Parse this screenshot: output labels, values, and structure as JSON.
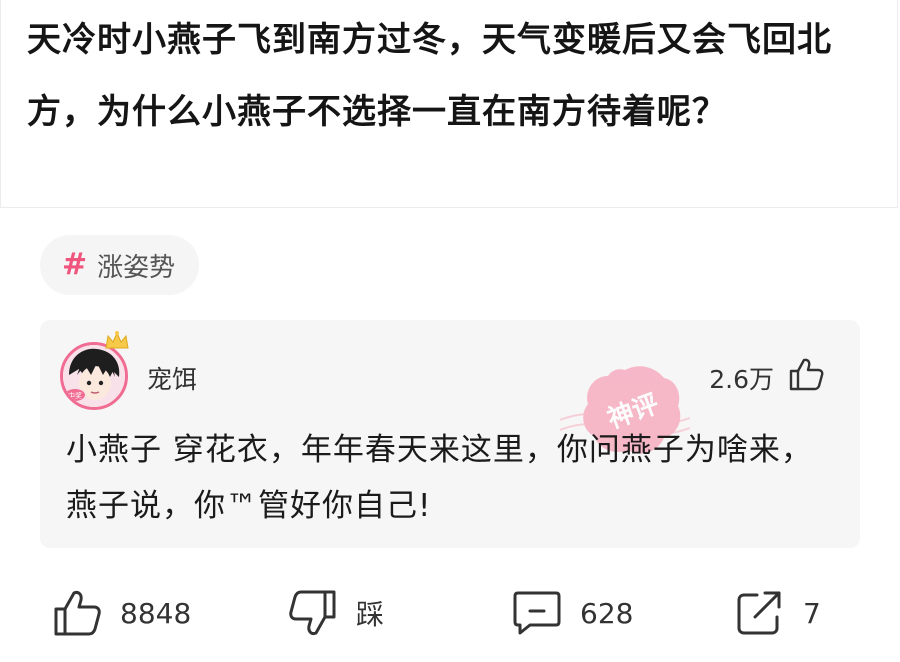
{
  "post": {
    "title": "天冷时小燕子飞到南方过冬，天气变暖后又会飞回北方，为什么小燕子不选择一直在南方待着呢？"
  },
  "topic": {
    "label": "涨姿势",
    "icon": "hash-icon"
  },
  "comment": {
    "username": "宠饵",
    "like_count": "2.6万",
    "text": "小燕子 穿花衣，年年春天来这里，你问燕子为啥来，燕子说，你™管好你自己!",
    "badge": "神评",
    "avatar_badge": "中奖"
  },
  "actions": {
    "like_count": "8848",
    "dislike_label": "踩",
    "comment_count": "628",
    "share_count": "7"
  },
  "colors": {
    "accent": "#f0557d",
    "stamp": "#f6a3b8",
    "card_bg": "#f6f6f6"
  }
}
